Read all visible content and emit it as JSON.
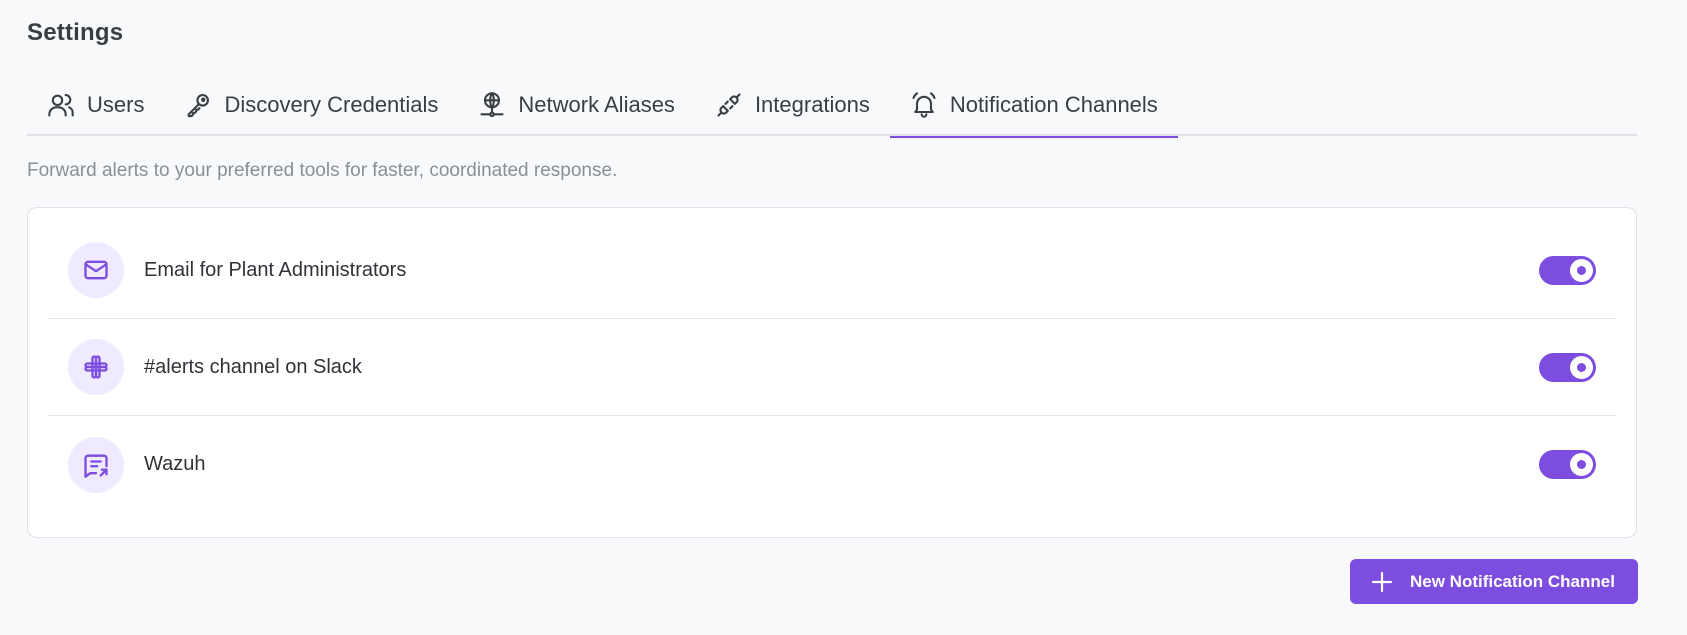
{
  "page": {
    "title": "Settings",
    "subtitle": "Forward alerts to your preferred tools for faster, coordinated response."
  },
  "tabs": [
    {
      "label": "Users",
      "icon": "users-icon",
      "active": false
    },
    {
      "label": "Discovery Credentials",
      "icon": "key-icon",
      "active": false
    },
    {
      "label": "Network Aliases",
      "icon": "network-globe-icon",
      "active": false
    },
    {
      "label": "Integrations",
      "icon": "plug-icon",
      "active": false
    },
    {
      "label": "Notification Channels",
      "icon": "bell-icon",
      "active": true
    }
  ],
  "channels": [
    {
      "label": "Email for Plant Administrators",
      "icon": "mail-icon",
      "enabled": true
    },
    {
      "label": "#alerts channel on Slack",
      "icon": "slack-icon",
      "enabled": true
    },
    {
      "label": "Wazuh",
      "icon": "message-share-icon",
      "enabled": true
    }
  ],
  "actions": {
    "new_channel_label": "New Notification Channel"
  },
  "colors": {
    "accent": "#7c4ddf",
    "icon_bg": "#efeaff"
  }
}
